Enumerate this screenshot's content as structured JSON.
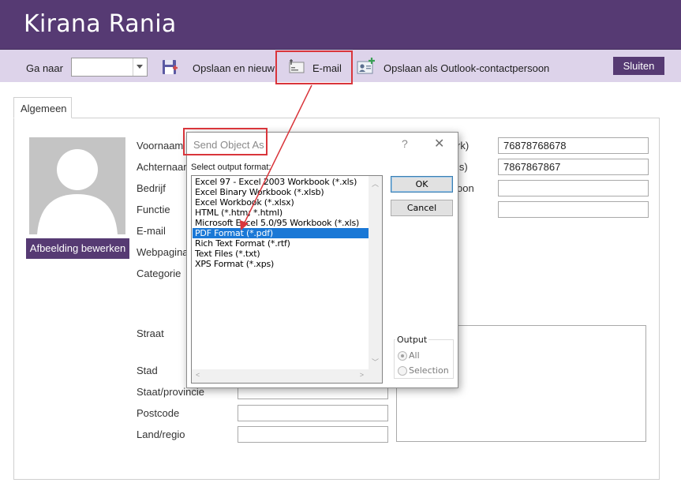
{
  "window": {
    "title": "Kirana Rania"
  },
  "toolbar": {
    "goto_label": "Ga naar",
    "goto_value": "",
    "save_new_label": "Opslaan en nieuw",
    "email_label": "E-mail",
    "save_outlook_label": "Opslaan als Outlook-contactpersoon",
    "close_label": "Sluiten"
  },
  "tabs": [
    {
      "label": "Algemeen"
    }
  ],
  "photo": {
    "edit_label": "Afbeelding bewerken"
  },
  "form": {
    "labels": [
      "Voornaam",
      "Achternaam",
      "Bedrijf",
      "Functie",
      "E-mail",
      "Webpagina",
      "Categorie",
      "Straat",
      "Stad",
      "Staat/provincie",
      "Postcode",
      "Land/regio"
    ],
    "right_labels_partial": [
      "rk)",
      "is)",
      "oon"
    ],
    "right_values": [
      "76878768678",
      "7867867867",
      "",
      ""
    ]
  },
  "dialog": {
    "title": "Send Object As",
    "help": "?",
    "close": "✕",
    "prompt": "Select output format:",
    "formats": [
      "Excel 97 - Excel 2003 Workbook (*.xls)",
      "Excel Binary Workbook (*.xlsb)",
      "Excel Workbook (*.xlsx)",
      "HTML (*.htm; *.html)",
      "Microsoft Excel 5.0/95 Workbook (*.xls)",
      "PDF Format (*.pdf)",
      "Rich Text Format (*.rtf)",
      "Text Files (*.txt)",
      "XPS Format (*.xps)"
    ],
    "selected_index": 5,
    "ok_label": "OK",
    "cancel_label": "Cancel",
    "output_label": "Output",
    "output_options": [
      "All",
      "Selection"
    ],
    "output_selected": "All"
  },
  "colors": {
    "brand": "#563a73",
    "toolbar_bg": "#ddd3ea",
    "selection": "#1a78d6",
    "annotation": "#d9353b"
  }
}
